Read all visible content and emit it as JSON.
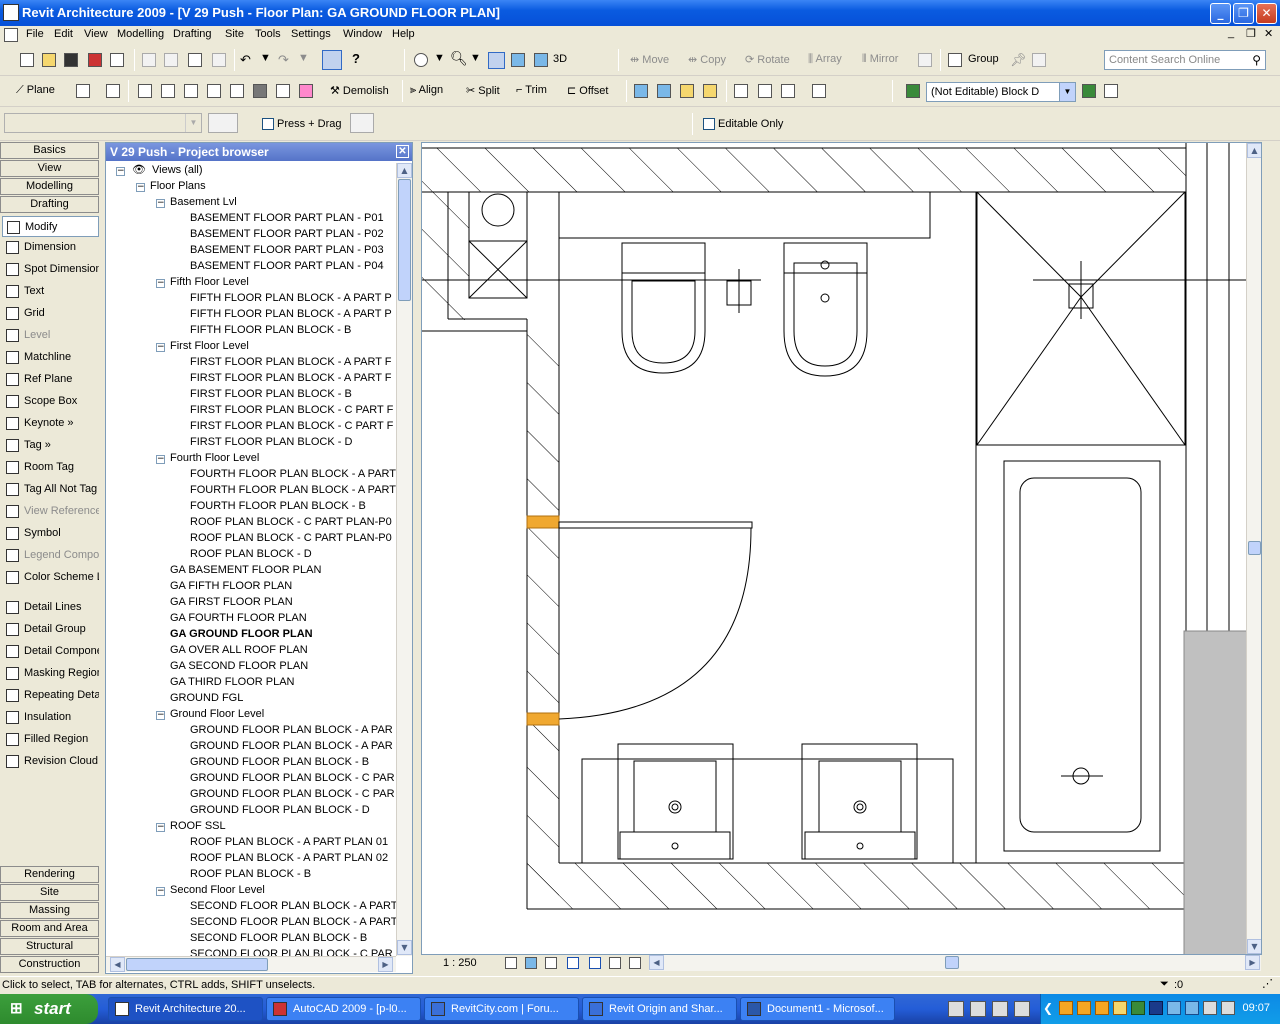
{
  "window": {
    "title": "Revit Architecture 2009 - [V 29 Push - Floor Plan: GA GROUND FLOOR PLAN]"
  },
  "menu": [
    "File",
    "Edit",
    "View",
    "Modelling",
    "Drafting",
    "Site",
    "Tools",
    "Settings",
    "Window",
    "Help"
  ],
  "toolbar1": {
    "move": "Move",
    "copy": "Copy",
    "rotate": "Rotate",
    "array": "Array",
    "mirror": "Mirror",
    "group": "Group",
    "view3d": "3D",
    "search_placeholder": "Content Search Online"
  },
  "toolbar2": {
    "plane": "Plane",
    "demolish": "Demolish",
    "align": "Align",
    "split": "Split",
    "trim": "Trim",
    "offset": "Offset",
    "workset_value": "(Not Editable) Block D"
  },
  "toolbar3": {
    "press_drag": "Press + Drag",
    "editable_only": "Editable Only"
  },
  "design_bar": {
    "tabs_top": [
      "Basics",
      "View",
      "Modelling",
      "Drafting"
    ],
    "items": [
      "Modify",
      "Dimension",
      "Spot Dimension",
      "Text",
      "Grid",
      "Level",
      "Matchline",
      "Ref Plane",
      "Scope Box",
      "Keynote »",
      "Tag »",
      "Room Tag",
      "Tag All Not Tag",
      "View Reference",
      "Symbol",
      "Legend Compor",
      "Color Scheme L",
      "Detail Lines",
      "Detail Group",
      "Detail Compone",
      "Masking Region",
      "Repeating Deta",
      "Insulation",
      "Filled Region",
      "Revision Cloud"
    ],
    "tabs_bottom": [
      "Rendering",
      "Site",
      "Massing",
      "Room and Area",
      "Structural",
      "Construction"
    ]
  },
  "browser": {
    "title": "V 29 Push - Project browser",
    "nodes": [
      {
        "label": "Views (all)",
        "level": 0,
        "toggle": "-"
      },
      {
        "label": "Floor Plans",
        "level": 1,
        "toggle": "-"
      },
      {
        "label": "Basement Lvl",
        "level": 2,
        "toggle": "-"
      },
      {
        "label": "BASEMENT FLOOR PART PLAN - P01",
        "level": 3
      },
      {
        "label": "BASEMENT FLOOR PART PLAN - P02",
        "level": 3
      },
      {
        "label": "BASEMENT FLOOR PART PLAN - P03",
        "level": 3
      },
      {
        "label": "BASEMENT FLOOR PART PLAN - P04",
        "level": 3
      },
      {
        "label": "Fifth Floor Level",
        "level": 2,
        "toggle": "-"
      },
      {
        "label": "FIFTH FLOOR PLAN BLOCK - A PART P",
        "level": 3
      },
      {
        "label": "FIFTH FLOOR PLAN BLOCK - A PART P",
        "level": 3
      },
      {
        "label": "FIFTH FLOOR PLAN BLOCK - B",
        "level": 3
      },
      {
        "label": "First Floor Level",
        "level": 2,
        "toggle": "-"
      },
      {
        "label": "FIRST FLOOR PLAN BLOCK - A PART F",
        "level": 3
      },
      {
        "label": "FIRST FLOOR PLAN BLOCK - A PART F",
        "level": 3
      },
      {
        "label": "FIRST FLOOR PLAN BLOCK - B",
        "level": 3
      },
      {
        "label": "FIRST FLOOR PLAN BLOCK - C PART F",
        "level": 3
      },
      {
        "label": "FIRST FLOOR PLAN BLOCK - C PART F",
        "level": 3
      },
      {
        "label": "FIRST FLOOR PLAN BLOCK - D",
        "level": 3
      },
      {
        "label": "Fourth Floor Level",
        "level": 2,
        "toggle": "-"
      },
      {
        "label": "FOURTH FLOOR PLAN BLOCK - A PART",
        "level": 3
      },
      {
        "label": "FOURTH FLOOR PLAN BLOCK - A PART",
        "level": 3
      },
      {
        "label": "FOURTH FLOOR PLAN BLOCK - B",
        "level": 3
      },
      {
        "label": "ROOF PLAN BLOCK - C PART PLAN-P0",
        "level": 3
      },
      {
        "label": "ROOF PLAN BLOCK - C PART PLAN-P0",
        "level": 3
      },
      {
        "label": "ROOF PLAN BLOCK - D",
        "level": 3
      },
      {
        "label": "GA BASEMENT FLOOR PLAN",
        "level": 2
      },
      {
        "label": "GA FIFTH FLOOR PLAN",
        "level": 2
      },
      {
        "label": "GA FIRST FLOOR PLAN",
        "level": 2
      },
      {
        "label": "GA FOURTH FLOOR PLAN",
        "level": 2
      },
      {
        "label": "GA GROUND FLOOR PLAN",
        "level": 2,
        "bold": true
      },
      {
        "label": "GA OVER ALL ROOF PLAN",
        "level": 2
      },
      {
        "label": "GA SECOND FLOOR PLAN",
        "level": 2
      },
      {
        "label": "GA THIRD FLOOR PLAN",
        "level": 2
      },
      {
        "label": "GROUND FGL",
        "level": 2
      },
      {
        "label": "Ground Floor Level",
        "level": 2,
        "toggle": "-"
      },
      {
        "label": "GROUND FLOOR PLAN BLOCK - A PAR",
        "level": 3
      },
      {
        "label": "GROUND FLOOR PLAN BLOCK - A PAR",
        "level": 3
      },
      {
        "label": "GROUND FLOOR PLAN BLOCK - B",
        "level": 3
      },
      {
        "label": "GROUND FLOOR PLAN BLOCK - C PAR",
        "level": 3
      },
      {
        "label": "GROUND FLOOR PLAN BLOCK - C PAR",
        "level": 3
      },
      {
        "label": "GROUND FLOOR PLAN BLOCK - D",
        "level": 3
      },
      {
        "label": "ROOF SSL",
        "level": 2,
        "toggle": "-"
      },
      {
        "label": "ROOF PLAN BLOCK - A PART PLAN 01",
        "level": 3
      },
      {
        "label": "ROOF PLAN BLOCK - A PART PLAN 02",
        "level": 3
      },
      {
        "label": "ROOF PLAN BLOCK - B",
        "level": 3
      },
      {
        "label": "Second Floor Level",
        "level": 2,
        "toggle": "-"
      },
      {
        "label": "SECOND FLOOR PLAN BLOCK - A PART",
        "level": 3
      },
      {
        "label": "SECOND FLOOR PLAN BLOCK - A PART",
        "level": 3
      },
      {
        "label": "SECOND FLOOR PLAN BLOCK - B",
        "level": 3
      },
      {
        "label": "SECOND FLOOR PLAN BLOCK - C PAR",
        "level": 3
      }
    ]
  },
  "view": {
    "scale": "1 : 250"
  },
  "status": {
    "hint": "Click to select, TAB for alternates, CTRL adds, SHIFT unselects.",
    "filter_count": ":0"
  },
  "taskbar": {
    "start": "start",
    "tasks": [
      "Revit Architecture 20...",
      "AutoCAD 2009 - [p-l0...",
      "RevitCity.com | Foru...",
      "Revit Origin and Shar...",
      "Document1 - Microsof..."
    ],
    "clock": "09:07"
  }
}
